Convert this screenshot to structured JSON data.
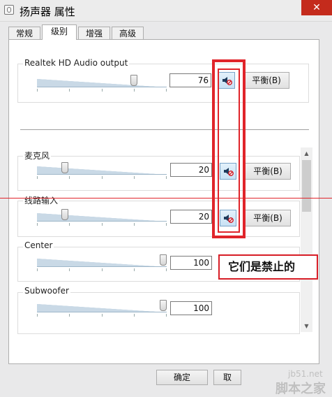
{
  "window": {
    "title": "扬声器 属性",
    "close_glyph": "✕"
  },
  "tabs": [
    {
      "label": "常规",
      "active": false
    },
    {
      "label": "级别",
      "active": true
    },
    {
      "label": "增强",
      "active": false
    },
    {
      "label": "高级",
      "active": false
    }
  ],
  "channels": {
    "master": {
      "label": "Realtek HD Audio output",
      "value": "76",
      "level": 0.76,
      "muted": false,
      "balance_label": "平衡(B)"
    },
    "mic": {
      "label": "麦克风",
      "value": "20",
      "level": 0.2,
      "muted": true,
      "balance_label": "平衡(B)"
    },
    "line_in": {
      "label": "线路输入",
      "value": "20",
      "level": 0.2,
      "muted": true,
      "balance_label": "平衡(B)"
    },
    "center": {
      "label": "Center",
      "value": "100",
      "level": 1.0
    },
    "subwoofer": {
      "label": "Subwoofer",
      "value": "100",
      "level": 1.0
    }
  },
  "annotation": {
    "callout_text": "它们是禁止的",
    "color": "#e0242a"
  },
  "footer": {
    "ok_label": "确定",
    "cancel_label": "取"
  },
  "watermark": {
    "line1": "jb51.net",
    "line2": "脚本之家"
  },
  "colors": {
    "accent": "#e0242a",
    "mute_button_bg": "#c8e1f4"
  },
  "icons": {
    "mute": "speaker-muted-icon",
    "close": "close-icon",
    "app": "speaker-app-icon"
  }
}
